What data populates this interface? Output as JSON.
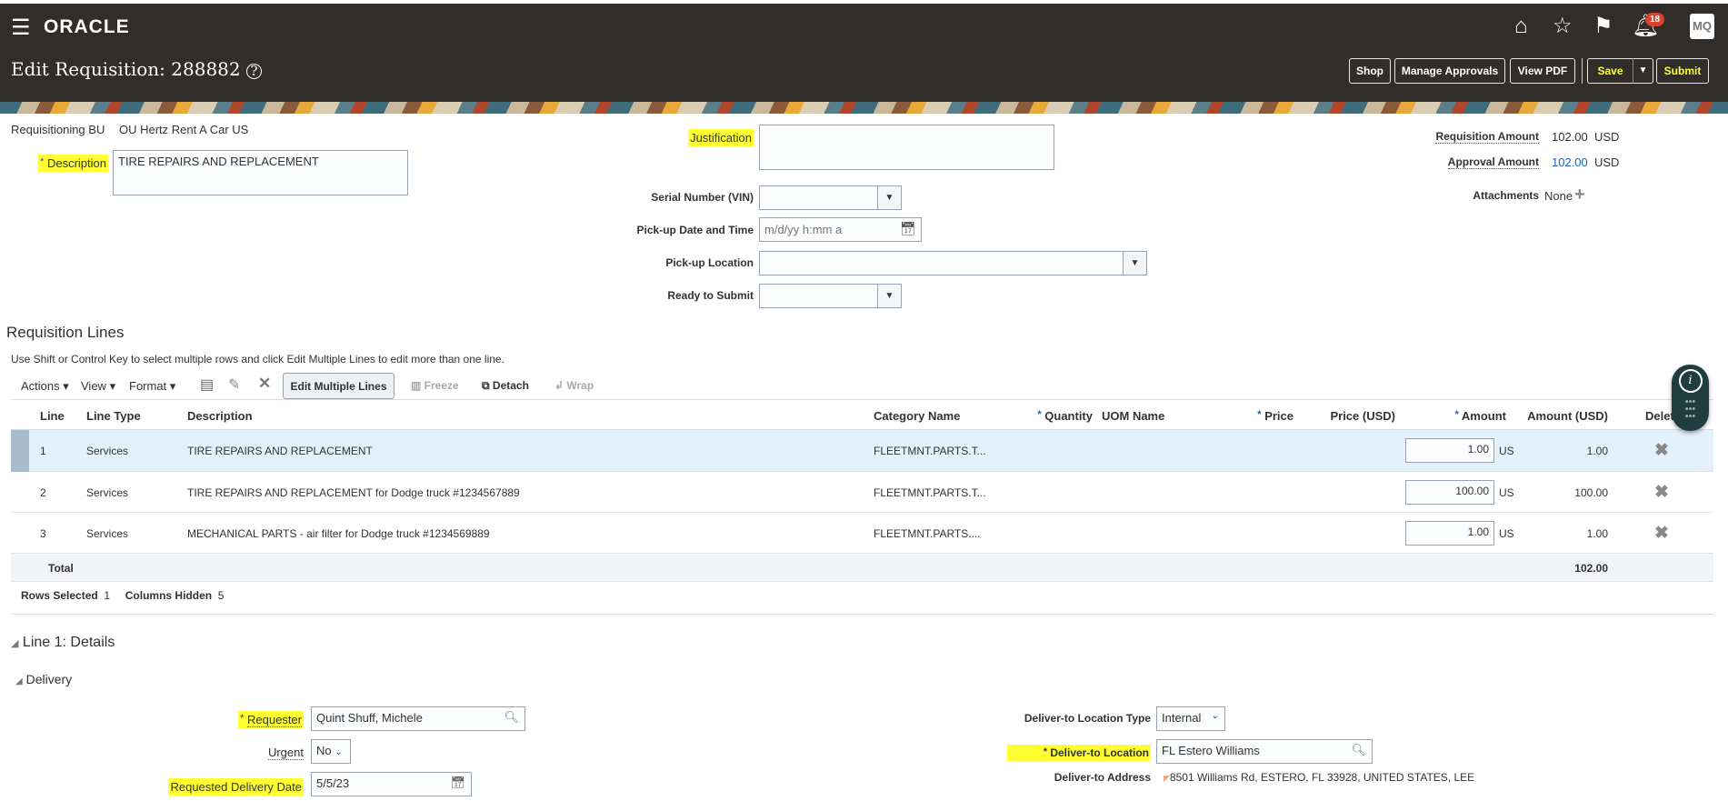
{
  "header": {
    "brand": "ORACLE",
    "title": "Edit Requisition: 288882",
    "notification_count": "18",
    "avatar": "MQ",
    "buttons": {
      "shop": "Shop",
      "manage_approvals": "Manage Approvals",
      "view_pdf": "View PDF",
      "save": "Save",
      "submit": "Submit"
    }
  },
  "form": {
    "requisitioning_bu_label": "Requisitioning BU",
    "requisitioning_bu": "OU Hertz Rent A Car US",
    "description_label": "Description",
    "description": "TIRE REPAIRS AND REPLACEMENT",
    "justification_label": "Justification",
    "justification": "",
    "serial_label": "Serial Number (VIN)",
    "serial": "",
    "pickup_date_label": "Pick-up Date and Time",
    "pickup_date_placeholder": "m/d/yy h:mm a",
    "pickup_location_label": "Pick-up Location",
    "pickup_location": "",
    "ready_label": "Ready to Submit",
    "ready": "",
    "req_amount_label": "Requisition Amount",
    "req_amount": "102.00",
    "req_currency": "USD",
    "approval_amount_label": "Approval Amount",
    "approval_amount": "102.00",
    "approval_currency": "USD",
    "attachments_label": "Attachments",
    "attachments": "None"
  },
  "lines": {
    "title": "Requisition Lines",
    "hint": "Use Shift or Control Key to select multiple rows and click Edit Multiple Lines to edit more than one line.",
    "toolbar": {
      "actions": "Actions",
      "view": "View",
      "format": "Format",
      "edit_multiple": "Edit Multiple Lines",
      "freeze": "Freeze",
      "detach": "Detach",
      "wrap": "Wrap"
    },
    "columns": [
      "Line",
      "Line Type",
      "Description",
      "Category Name",
      "Quantity",
      "UOM Name",
      "Price",
      "Price (USD)",
      "Amount",
      "Amount (USD)",
      "Delete"
    ],
    "rows": [
      {
        "line": "1",
        "type": "Services",
        "description": "TIRE REPAIRS AND REPLACEMENT",
        "category": "FLEETMNT.PARTS.T...",
        "amount": "1.00",
        "currency": "US",
        "amount_usd": "1.00",
        "selected": true
      },
      {
        "line": "2",
        "type": "Services",
        "description": "TIRE REPAIRS AND REPLACEMENT for Dodge truck #1234567889",
        "category": "FLEETMNT.PARTS.T...",
        "amount": "100.00",
        "currency": "US",
        "amount_usd": "100.00",
        "selected": false
      },
      {
        "line": "3",
        "type": "Services",
        "description": "MECHANICAL PARTS - air filter for Dodge truck #1234569889",
        "category": "FLEETMNT.PARTS....",
        "amount": "1.00",
        "currency": "US",
        "amount_usd": "1.00",
        "selected": false
      }
    ],
    "total_label": "Total",
    "total": "102.00",
    "rows_selected_label": "Rows Selected",
    "rows_selected": "1",
    "columns_hidden_label": "Columns Hidden",
    "columns_hidden": "5"
  },
  "details": {
    "title": "Line 1: Details",
    "delivery": "Delivery",
    "requester_label": "Requester",
    "requester": "Quint Shuff, Michele",
    "urgent_label": "Urgent",
    "urgent": "No",
    "delivery_date_label": "Requested Delivery Date",
    "delivery_date": "5/5/23",
    "loc_type_label": "Deliver-to Location Type",
    "loc_type": "Internal",
    "location_label": "Deliver-to Location",
    "location": "FL Estero Williams",
    "address_label": "Deliver-to Address",
    "address": "8501 Williams Rd, ESTERO, FL 33928, UNITED STATES, LEE"
  },
  "colors": {
    "header_bg": "#312d2a",
    "highlight": "#ffff33",
    "selected_row": "#e4f0fc"
  }
}
